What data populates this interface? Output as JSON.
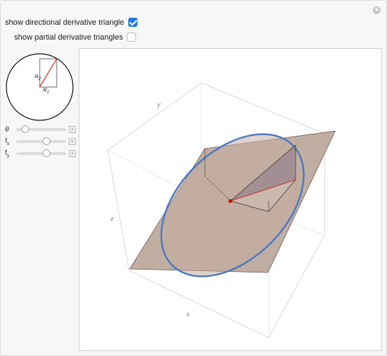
{
  "controls": {
    "dir_triangle_label": "show directional derivative triangle",
    "dir_triangle_checked": true,
    "partial_triangles_label": "show partial derivative triangles",
    "partial_triangles_checked": false
  },
  "unit_circle": {
    "u1_label": "u",
    "u1_sub": "1",
    "u2_label": "u",
    "u2_sub": "2"
  },
  "sliders": [
    {
      "label": "θ",
      "sub": "",
      "value_fraction": 0.12
    },
    {
      "label": "f",
      "sub": "x",
      "value_fraction": 0.62
    },
    {
      "label": "f",
      "sub": "y",
      "value_fraction": 0.62
    }
  ],
  "plot": {
    "x_label": "x",
    "y_label": "y",
    "z_label": "z",
    "colors": {
      "plane": "#b39b8e",
      "ellipse": "#4a78c2",
      "triangle": "#8c7a86",
      "direction": "#d63a2e"
    }
  }
}
